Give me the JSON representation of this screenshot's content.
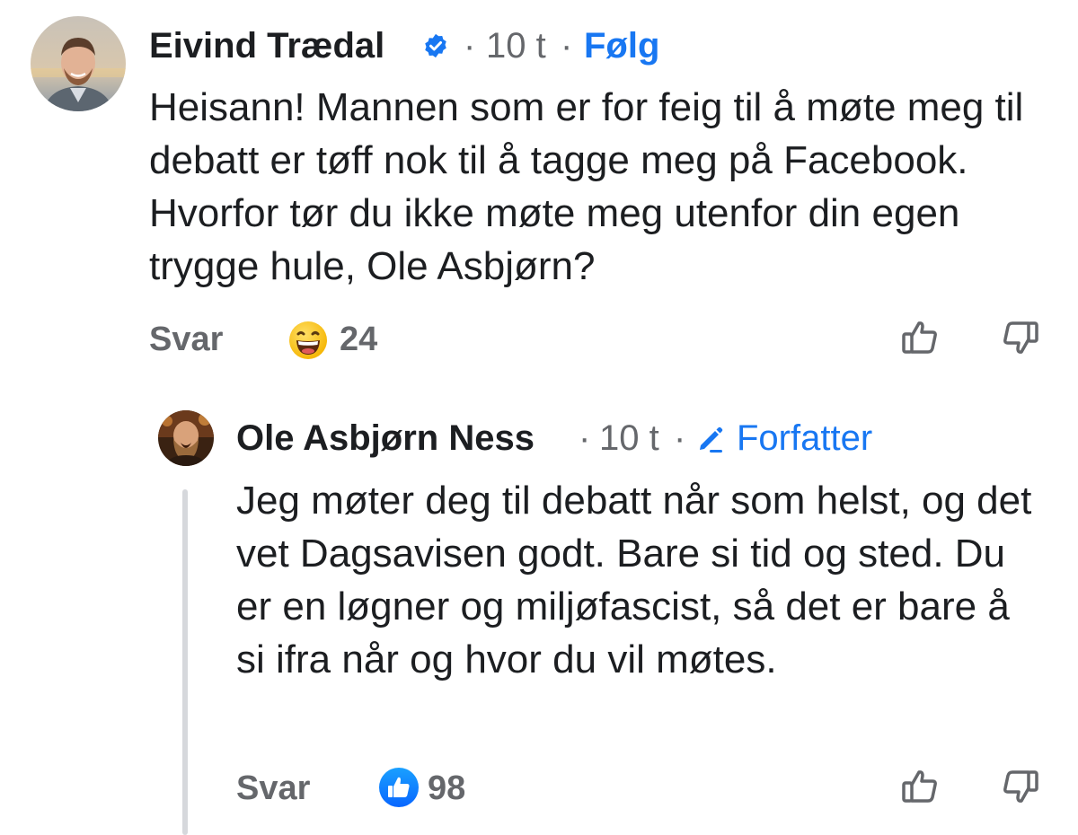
{
  "comments": [
    {
      "author": "Eivind Trædal",
      "verified": true,
      "time_sep": "·",
      "time": "10 t",
      "action_sep": "·",
      "action": "Følg",
      "text": "Heisann! Mannen som er for feig til å møte meg til debatt er tøff nok til å tagge meg på Facebook. Hvorfor tør du ikke møte meg utenfor din egen trygge hule, Ole Asbjørn?",
      "reply_label": "Svar",
      "reaction_icon": "grinning-face-emoji",
      "reaction_count": "24"
    },
    {
      "author": "Ole Asbjørn Ness",
      "time_sep": "·",
      "time": "10 t",
      "badge_sep": "·",
      "badge_icon": "pencil-icon",
      "badge": "Forfatter",
      "text": "Jeg møter deg til debatt når som helst, og det vet Dagsavisen godt. Bare si tid og sted. Du er en løgner og miljøfascist, så det er bare å si ifra når og hvor du vil møtes.",
      "reply_label": "Svar",
      "reaction_icon": "like-thumb-icon",
      "reaction_count": "98"
    }
  ],
  "colors": {
    "accent": "#1877f2",
    "secondary_text": "#65676b",
    "primary_text": "#1c1e21",
    "thread_line": "#d6d8dc"
  }
}
